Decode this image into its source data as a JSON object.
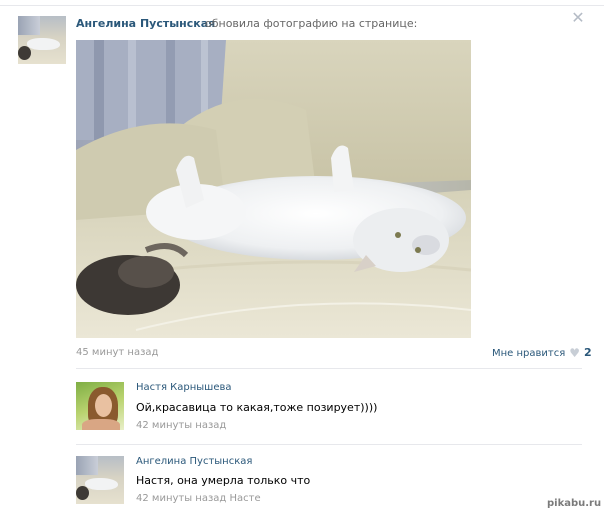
{
  "post": {
    "author": "Ангелина Пустынская",
    "action": "обновила фотографию на странице:",
    "close_icon": "✕",
    "time": "45 минут назад",
    "like_label": "Мне нравится",
    "like_icon": "♥",
    "like_count": "2"
  },
  "comments": [
    {
      "name": "Настя Карнышева",
      "text": "Ой,красавица то какая,тоже позирует))))",
      "time": "42 минуты назад",
      "reply_to": ""
    },
    {
      "name": "Ангелина Пустынская",
      "text": "Настя, она умерла только что",
      "time": "42 минуты назад",
      "reply_to": "Насте"
    }
  ],
  "watermark": "pikabu.ru"
}
